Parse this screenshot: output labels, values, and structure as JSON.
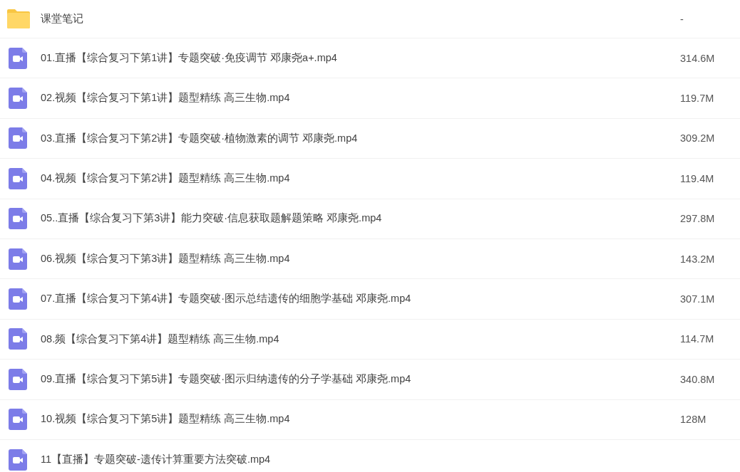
{
  "file_list": {
    "items": [
      {
        "kind": "folder",
        "name": "课堂笔记",
        "size": "-"
      },
      {
        "kind": "video",
        "name": "01.直播【综合复习下第1讲】专题突破·免疫调节 邓康尧a+.mp4",
        "size": "314.6M"
      },
      {
        "kind": "video",
        "name": "02.视频【综合复习下第1讲】题型精练 高三生物.mp4",
        "size": "119.7M"
      },
      {
        "kind": "video",
        "name": "03.直播【综合复习下第2讲】专题突破·植物激素的调节 邓康尧.mp4",
        "size": "309.2M"
      },
      {
        "kind": "video",
        "name": "04.视频【综合复习下第2讲】题型精练 高三生物.mp4",
        "size": "119.4M"
      },
      {
        "kind": "video",
        "name": "05..直播【综合复习下第3讲】能力突破·信息获取题解题策略 邓康尧.mp4",
        "size": "297.8M"
      },
      {
        "kind": "video",
        "name": "06.视频【综合复习下第3讲】题型精练 高三生物.mp4",
        "size": "143.2M"
      },
      {
        "kind": "video",
        "name": "07.直播【综合复习下第4讲】专题突破·图示总结遗传的细胞学基础 邓康尧.mp4",
        "size": "307.1M"
      },
      {
        "kind": "video",
        "name": "08.频【综合复习下第4讲】题型精练 高三生物.mp4",
        "size": "114.7M"
      },
      {
        "kind": "video",
        "name": "09.直播【综合复习下第5讲】专题突破·图示归纳遗传的分子学基础 邓康尧.mp4",
        "size": "340.8M"
      },
      {
        "kind": "video",
        "name": "10.视频【综合复习下第5讲】题型精练 高三生物.mp4",
        "size": "128M"
      },
      {
        "kind": "video",
        "name": "11【直播】专题突破-遗传计算重要方法突破.mp4"
      }
    ]
  }
}
